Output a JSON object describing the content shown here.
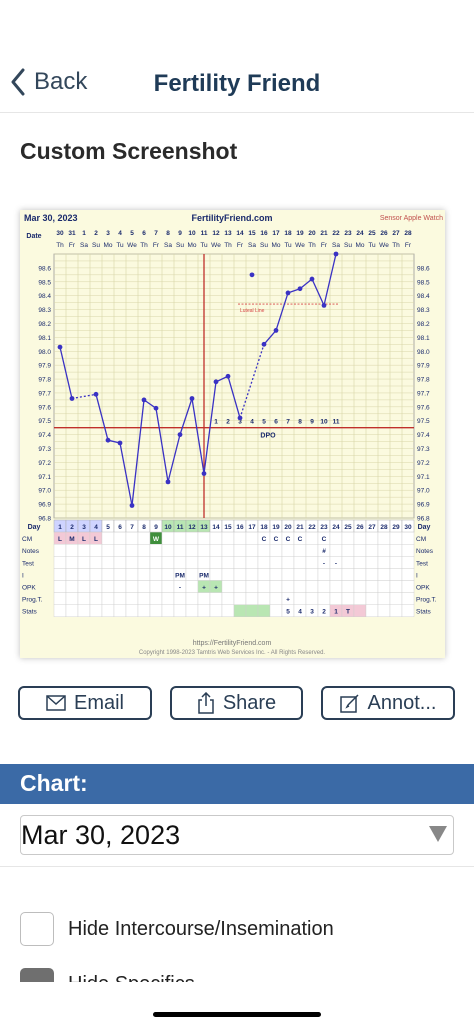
{
  "nav": {
    "back_label": "Back",
    "title": "Fertility Friend"
  },
  "section_title": "Custom Screenshot",
  "chart_header": {
    "date": "Mar 30, 2023",
    "site": "FertilityFriend.com",
    "sensor": "Sensor Apple Watch"
  },
  "chart_data": {
    "type": "line",
    "date_label": "Date",
    "dates": [
      "30",
      "31",
      "1",
      "2",
      "3",
      "4",
      "5",
      "6",
      "7",
      "8",
      "9",
      "10",
      "11",
      "12",
      "13",
      "14",
      "15",
      "16",
      "17",
      "18",
      "19",
      "20",
      "21",
      "22",
      "23",
      "24",
      "25",
      "26",
      "27",
      "28"
    ],
    "weekdays": [
      "Th",
      "Fr",
      "Sa",
      "Su",
      "Mo",
      "Tu",
      "We",
      "Th",
      "Fr",
      "Sa",
      "Su",
      "Mo",
      "Tu",
      "We",
      "Th",
      "Fr",
      "Sa",
      "Su",
      "Mo",
      "Tu",
      "We",
      "Th",
      "Fr",
      "Sa",
      "Su",
      "Mo",
      "Tu",
      "We",
      "Th",
      "Fr"
    ],
    "day_label": "Day",
    "days": [
      "1",
      "2",
      "3",
      "4",
      "5",
      "6",
      "7",
      "8",
      "9",
      "10",
      "11",
      "12",
      "13",
      "14",
      "15",
      "16",
      "17",
      "18",
      "19",
      "20",
      "21",
      "22",
      "23",
      "24",
      "25",
      "26",
      "27",
      "28",
      "29",
      "30"
    ],
    "y_ticks": [
      "98.6",
      "98.5",
      "98.4",
      "98.3",
      "98.2",
      "98.1",
      "98.0",
      "97.9",
      "97.8",
      "97.7",
      "97.6",
      "97.5",
      "97.4",
      "97.3",
      "97.2",
      "97.1",
      "97.0",
      "96.9",
      "96.8"
    ],
    "ylim": [
      96.8,
      98.7
    ],
    "temps": [
      98.03,
      97.66,
      null,
      97.69,
      97.36,
      97.34,
      96.89,
      97.65,
      97.59,
      97.06,
      97.4,
      97.66,
      97.12,
      97.78,
      97.82,
      97.52,
      98.55,
      98.05,
      98.15,
      98.42,
      98.45,
      98.52,
      98.33,
      98.7
    ],
    "coverline": 97.45,
    "ovulation_day": 13,
    "lutheal_label": "Luteal Line",
    "luteal_line_level": 98.34,
    "dpo_numbers": [
      "1",
      "2",
      "3",
      "4",
      "5",
      "6",
      "7",
      "8",
      "9",
      "10",
      "11"
    ],
    "dpo_label": "DPO",
    "rows": {
      "cm": {
        "label": "CM",
        "cells": [
          "L",
          "M",
          "L",
          "L",
          "",
          "",
          "",
          "",
          "W",
          "",
          "",
          "",
          "",
          "",
          "",
          "",
          "",
          "C",
          "C",
          "C",
          "C",
          "",
          "C",
          "",
          "",
          "",
          "",
          "",
          "",
          ""
        ]
      },
      "notes": {
        "label": "Notes",
        "cells": [
          "",
          "",
          "",
          "",
          "",
          "",
          "",
          "",
          "",
          "",
          "",
          "",
          "",
          "",
          "",
          "",
          "",
          "",
          "",
          "",
          "",
          "",
          "#",
          "",
          "",
          "",
          "",
          "",
          "",
          ""
        ]
      },
      "test": {
        "label": "Test",
        "cells": [
          "",
          "",
          "",
          "",
          "",
          "",
          "",
          "",
          "",
          "",
          "",
          "",
          "",
          "",
          "",
          "",
          "",
          "",
          "",
          "",
          "",
          "",
          "-",
          "-",
          "",
          "",
          "",
          "",
          "",
          ""
        ]
      },
      "intercourse": {
        "label": "I",
        "cells": [
          "",
          "",
          "",
          "",
          "",
          "",
          "",
          "",
          "",
          "",
          "PM",
          "",
          "PM",
          "",
          "",
          "",
          "",
          "",
          "",
          "",
          "",
          "",
          "",
          "",
          "",
          "",
          "",
          "",
          "",
          ""
        ]
      },
      "opk": {
        "label": "OPK",
        "cells": [
          "",
          "",
          "",
          "",
          "",
          "",
          "",
          "",
          "",
          "",
          "-",
          "",
          "+",
          "+",
          "",
          "",
          "",
          "",
          "",
          "",
          "",
          "",
          "",
          "",
          "",
          "",
          "",
          "",
          "",
          ""
        ]
      },
      "prog": {
        "label": "Prog.T.",
        "cells": [
          "",
          "",
          "",
          "",
          "",
          "",
          "",
          "",
          "",
          "",
          "",
          "",
          "",
          "",
          "",
          "",
          "",
          "",
          "",
          "+",
          "",
          "",
          "",
          "",
          "",
          "",
          "",
          "",
          "",
          ""
        ]
      },
      "stats": {
        "label": "Stats",
        "cells": [
          "",
          "",
          "",
          "",
          "",
          "",
          "",
          "",
          "",
          "",
          "",
          "",
          "",
          "",
          "",
          "",
          "",
          "",
          "",
          "5",
          "4",
          "3",
          "2",
          "1",
          "T",
          "",
          "",
          "",
          "",
          ""
        ]
      }
    },
    "footer_url": "https://FertilityFriend.com",
    "footer_copy": "Copyright 1998-2023 Tamtris Web Services Inc. - All Rights Reserved.",
    "colors": {
      "line": "#3a32c4",
      "coverline": "#c0302b",
      "luteal": "#d64545",
      "period": "#f3c9d6",
      "fertile": "#b9e6b3",
      "grid": "#d8d5a8"
    }
  },
  "actions": {
    "email": "Email",
    "share": "Share",
    "annotate": "Annot..."
  },
  "chart_section": {
    "label": "Chart:",
    "selected_date": "Mar 30, 2023"
  },
  "options": [
    {
      "label": "Hide Intercourse/Insemination",
      "checked": false
    },
    {
      "label": "Hide Specifics",
      "checked": true
    }
  ]
}
